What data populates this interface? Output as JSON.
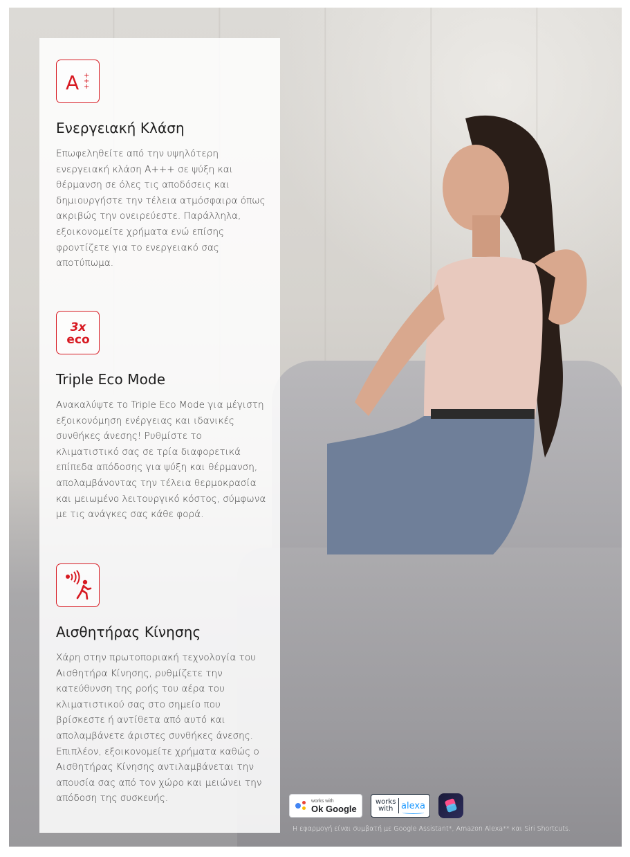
{
  "colors": {
    "accent": "#d71921",
    "panel": "#ffffff"
  },
  "features": [
    {
      "icon": "energy-class-icon",
      "icon_text": "A",
      "title": "Ενεργειακή Κλάση",
      "body": "Επωφεληθείτε από την υψηλότερη ενεργειακή κλάση Α+++ σε ψύξη και θέρμανση σε όλες τις αποδόσεις και δημιουργήστε την τέλεια ατμόσφαιρα όπως ακριβώς την ονειρεύεστε. Παράλληλα, εξοικονομείτε χρήματα ενώ επίσης φροντίζετε για το ενεργειακό σας αποτύπωμα."
    },
    {
      "icon": "triple-eco-icon",
      "icon_text_top": "3x",
      "icon_text_bottom": "eco",
      "title": "Triple Eco Mode",
      "body": "Ανακαλύψτε το Triple Eco Mode για μέγιστη εξοικονόμηση ενέργειας και ιδανικές συνθήκες άνεσης! Ρυθμίστε το κλιματιστικό σας σε τρία διαφορετικά επίπεδα απόδοσης για ψύξη και θέρμανση, απολαμβάνοντας την τέλεια θερμοκρασία και μειωμένο λειτουργικό κόστος, σύμφωνα με τις ανάγκες σας κάθε φορά."
    },
    {
      "icon": "motion-sensor-icon",
      "title": "Αισθητήρας Κίνησης",
      "body": "Χάρη στην πρωτοποριακή τεχνολογία του Αισθητήρα Κίνησης, ρυθμίζετε την κατεύθυνση της ροής του αέρα του κλιματιστικού σας στο σημείο που βρίσκεστε ή αντίθετα από αυτό και απολαμβάνετε άριστες συνθήκες άνεσης. Επιπλέον, εξοικονομείτε χρήματα καθώς ο Αισθητήρας Κίνησης αντιλαμβάνεται την απουσία σας από τον χώρο και μειώνει την απόδοση της συσκευής."
    }
  ],
  "badges": {
    "google": {
      "small": "works with",
      "big": "Ok Google"
    },
    "alexa": {
      "works": "works",
      "with": "with",
      "name": "alexa"
    },
    "shortcuts": {
      "icon": "siri-shortcuts-icon"
    }
  },
  "footnote": "Η εφαρμογή είναι συμβατή με Google Assistant*, Amazon Alexa** και Siri Shortcuts."
}
